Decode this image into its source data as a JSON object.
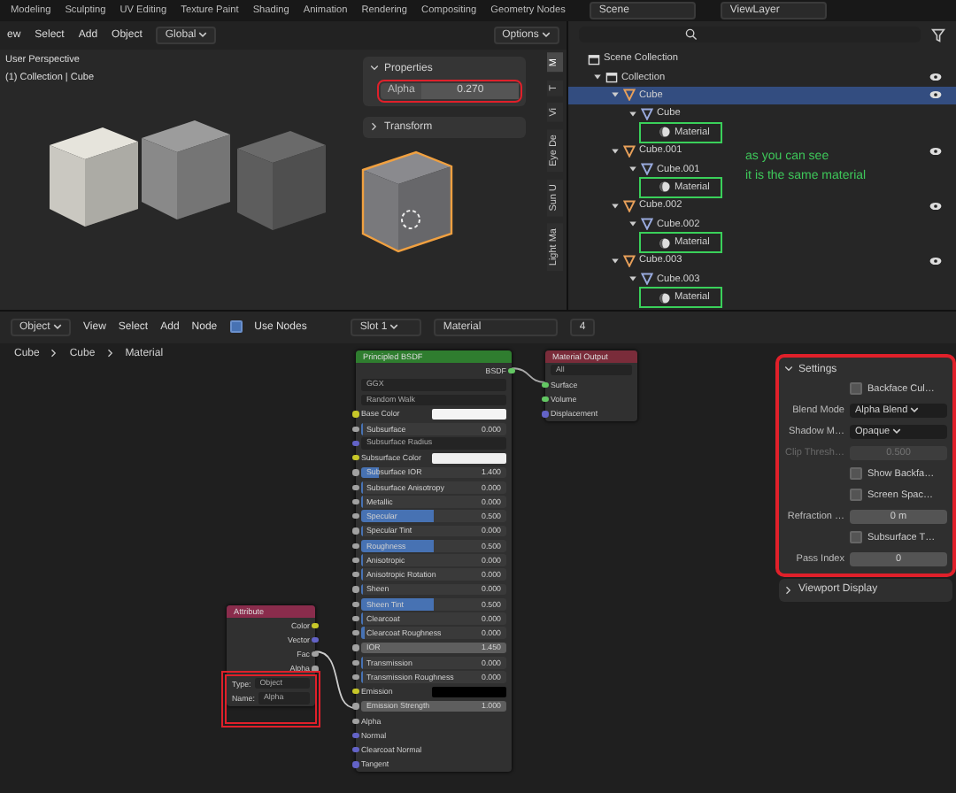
{
  "workspace_tabs": [
    "Modeling",
    "Sculpting",
    "UV Editing",
    "Texture Paint",
    "Shading",
    "Animation",
    "Rendering",
    "Compositing",
    "Geometry Nodes"
  ],
  "scene": "Scene",
  "view_layer": "ViewLayer",
  "viewport": {
    "menus": [
      "ew",
      "Select",
      "Add",
      "Object"
    ],
    "orientation": "Global",
    "options": "Options",
    "overlay_lines": [
      "User Perspective",
      "(1) Collection | Cube"
    ],
    "properties_panel": {
      "title": "Properties",
      "expanded": true,
      "field": {
        "label": "Alpha",
        "value": "0.270"
      }
    },
    "transform_panel": {
      "title": "Transform",
      "expanded": false
    },
    "sidebar_tabs": [
      {
        "label": "M",
        "selected": true
      },
      {
        "label": "T",
        "selected": false
      },
      {
        "label": "Vi",
        "selected": false
      },
      {
        "label": "Eye De",
        "selected": false
      },
      {
        "label": "Sun U",
        "selected": false
      },
      {
        "label": "Light Ma",
        "selected": false
      }
    ],
    "cubes": [
      {
        "color": "#e6e4dc",
        "selected": false
      },
      {
        "color": "#9c9c9c",
        "selected": false
      },
      {
        "color": "#6a6a6a",
        "selected": false
      },
      {
        "color": "#8a8a8e",
        "selected": true
      }
    ]
  },
  "outliner": {
    "items": [
      {
        "label": "Scene Collection",
        "kind": "scene",
        "selected": false,
        "children": [
          {
            "label": "Collection",
            "kind": "collection",
            "selected": false,
            "expanded": true,
            "children": [
              {
                "label": "Cube",
                "kind": "object",
                "selected": true,
                "expanded": true,
                "children": [
                  {
                    "label": "Cube",
                    "kind": "mesh",
                    "selected": false,
                    "expanded": true,
                    "children": [
                      {
                        "label": "Material",
                        "kind": "material",
                        "selected": false
                      }
                    ]
                  }
                ]
              },
              {
                "label": "Cube.001",
                "kind": "object",
                "selected": false,
                "expanded": true,
                "children": [
                  {
                    "label": "Cube.001",
                    "kind": "mesh",
                    "selected": false,
                    "expanded": true,
                    "children": [
                      {
                        "label": "Material",
                        "kind": "material",
                        "selected": false
                      }
                    ]
                  }
                ]
              },
              {
                "label": "Cube.002",
                "kind": "object",
                "selected": false,
                "expanded": true,
                "children": [
                  {
                    "label": "Cube.002",
                    "kind": "mesh",
                    "selected": false,
                    "expanded": true,
                    "children": [
                      {
                        "label": "Material",
                        "kind": "material",
                        "selected": false
                      }
                    ]
                  }
                ]
              },
              {
                "label": "Cube.003",
                "kind": "object",
                "selected": false,
                "expanded": true,
                "children": [
                  {
                    "label": "Cube.003",
                    "kind": "mesh",
                    "selected": false,
                    "expanded": true,
                    "children": [
                      {
                        "label": "Material",
                        "kind": "material",
                        "selected": false
                      }
                    ]
                  }
                ]
              }
            ]
          }
        ]
      }
    ],
    "note_lines": [
      "as you can see",
      "it is the same material"
    ]
  },
  "node_editor": {
    "mode": "Object",
    "menus": [
      "View",
      "Select",
      "Add",
      "Node"
    ],
    "use_nodes": {
      "label": "Use Nodes",
      "checked": true
    },
    "slot": "Slot 1",
    "material": "Material",
    "users": "4",
    "breadcrumb": [
      "Cube",
      "Cube",
      "Material"
    ],
    "nodes": [
      {
        "kind": "shader",
        "title": "Principled BSDF",
        "rows": [
          {
            "kind": "output",
            "label": "BSDF",
            "socket": {
              "color": "#63c763"
            }
          },
          {
            "kind": "dropdown",
            "value": "GGX"
          },
          {
            "kind": "dropdown",
            "value": "Random Walk"
          },
          {
            "kind": "color",
            "label": "Base Color",
            "socket": {
              "color": "#c7c729"
            },
            "color": "#f4f4f4"
          },
          {
            "kind": "value",
            "label": "Subsurface",
            "value": "0.000",
            "socket": {
              "color": "#a1a1a1"
            },
            "level": 0
          },
          {
            "kind": "dropdown",
            "value": "Subsurface Radius",
            "socket": {
              "color": "#6363c7"
            }
          },
          {
            "kind": "color",
            "label": "Subsurface Color",
            "socket": {
              "color": "#c7c729"
            },
            "color": "#f0f0f0"
          },
          {
            "kind": "value",
            "label": "Subsurface IOR",
            "value": "1.400",
            "socket": {
              "color": "#a1a1a1"
            },
            "level": 0.12
          },
          {
            "kind": "value",
            "label": "Subsurface Anisotropy",
            "value": "0.000",
            "socket": {
              "color": "#a1a1a1"
            },
            "level": 0
          },
          {
            "kind": "value",
            "label": "Metallic",
            "value": "0.000",
            "socket": {
              "color": "#a1a1a1"
            },
            "level": 0
          },
          {
            "kind": "value",
            "label": "Specular",
            "value": "0.500",
            "socket": {
              "color": "#a1a1a1"
            },
            "level": 0.5
          },
          {
            "kind": "value",
            "label": "Specular Tint",
            "value": "0.000",
            "socket": {
              "color": "#a1a1a1"
            },
            "level": 0
          },
          {
            "kind": "value",
            "label": "Roughness",
            "value": "0.500",
            "socket": {
              "color": "#a1a1a1"
            },
            "level": 0.5
          },
          {
            "kind": "value",
            "label": "Anisotropic",
            "value": "0.000",
            "socket": {
              "color": "#a1a1a1"
            },
            "level": 0
          },
          {
            "kind": "value",
            "label": "Anisotropic Rotation",
            "value": "0.000",
            "socket": {
              "color": "#a1a1a1"
            },
            "level": 0
          },
          {
            "kind": "value",
            "label": "Sheen",
            "value": "0.000",
            "socket": {
              "color": "#a1a1a1"
            },
            "level": 0
          },
          {
            "kind": "value",
            "label": "Sheen Tint",
            "value": "0.500",
            "socket": {
              "color": "#a1a1a1"
            },
            "level": 0.5
          },
          {
            "kind": "value",
            "label": "Clearcoat",
            "value": "0.000",
            "socket": {
              "color": "#a1a1a1"
            },
            "level": 0
          },
          {
            "kind": "value",
            "label": "Clearcoat Roughness",
            "value": "0.000",
            "socket": {
              "color": "#a1a1a1"
            },
            "level": 0.03
          },
          {
            "kind": "number",
            "label": "IOR",
            "value": "1.450",
            "socket": {
              "color": "#a1a1a1"
            }
          },
          {
            "kind": "value",
            "label": "Transmission",
            "value": "0.000",
            "socket": {
              "color": "#a1a1a1"
            },
            "level": 0
          },
          {
            "kind": "value",
            "label": "Transmission Roughness",
            "value": "0.000",
            "socket": {
              "color": "#a1a1a1"
            },
            "level": 0
          },
          {
            "kind": "color",
            "label": "Emission",
            "socket": {
              "color": "#c7c729"
            },
            "color": "#000000"
          },
          {
            "kind": "number",
            "label": "Emission Strength",
            "value": "1.000",
            "socket": {
              "color": "#a1a1a1"
            }
          },
          {
            "kind": "input",
            "label": "Alpha",
            "socket": {
              "color": "#a1a1a1"
            }
          },
          {
            "kind": "input",
            "label": "Normal",
            "socket": {
              "color": "#6363c7"
            }
          },
          {
            "kind": "input",
            "label": "Clearcoat Normal",
            "socket": {
              "color": "#6363c7"
            }
          },
          {
            "kind": "input",
            "label": "Tangent",
            "socket": {
              "color": "#6363c7"
            }
          }
        ]
      },
      {
        "kind": "output_node",
        "title": "Material Output",
        "rows": [
          {
            "kind": "dropdown",
            "value": "All"
          },
          {
            "kind": "input",
            "label": "Surface",
            "socket": {
              "color": "#63c763"
            }
          },
          {
            "kind": "input",
            "label": "Volume",
            "socket": {
              "color": "#63c763"
            }
          },
          {
            "kind": "input",
            "label": "Displacement",
            "socket": {
              "color": "#6363c7"
            }
          }
        ]
      },
      {
        "kind": "input_node",
        "title": "Attribute",
        "rows": [
          {
            "kind": "output",
            "label": "Color",
            "socket": {
              "color": "#c7c729"
            }
          },
          {
            "kind": "output",
            "label": "Vector",
            "socket": {
              "color": "#6363c7"
            }
          },
          {
            "kind": "output",
            "label": "Fac",
            "socket": {
              "color": "#a1a1a1"
            }
          },
          {
            "kind": "output",
            "label": "Alpha",
            "socket": {
              "color": "#a1a1a1"
            }
          },
          {
            "kind": "field",
            "label": "Type:",
            "value": "Object"
          },
          {
            "kind": "field",
            "label": "Name:",
            "value": "Alpha"
          }
        ]
      }
    ],
    "settings": {
      "title": "Settings",
      "expanded": true,
      "rows": [
        {
          "kind": "checkbox",
          "label": "Backface Cul…",
          "checked": false
        },
        {
          "kind": "select",
          "label": "Blend Mode",
          "value": "Alpha Blend"
        },
        {
          "kind": "select",
          "label": "Shadow M…",
          "value": "Opaque"
        },
        {
          "kind": "number",
          "label": "Clip Thresh…",
          "value": "0.500",
          "disabled": true
        },
        {
          "kind": "checkbox",
          "label": "Show Backfa…",
          "checked": false
        },
        {
          "kind": "checkbox",
          "label": "Screen Spac…",
          "checked": false
        },
        {
          "kind": "number",
          "label": "Refraction …",
          "value": "0 m",
          "disabled": false
        },
        {
          "kind": "checkbox",
          "label": "Subsurface T…",
          "checked": false
        },
        {
          "kind": "number",
          "label": "Pass Index",
          "value": "0",
          "disabled": false
        }
      ]
    },
    "viewport_display": {
      "title": "Viewport Display",
      "expanded": false
    }
  }
}
